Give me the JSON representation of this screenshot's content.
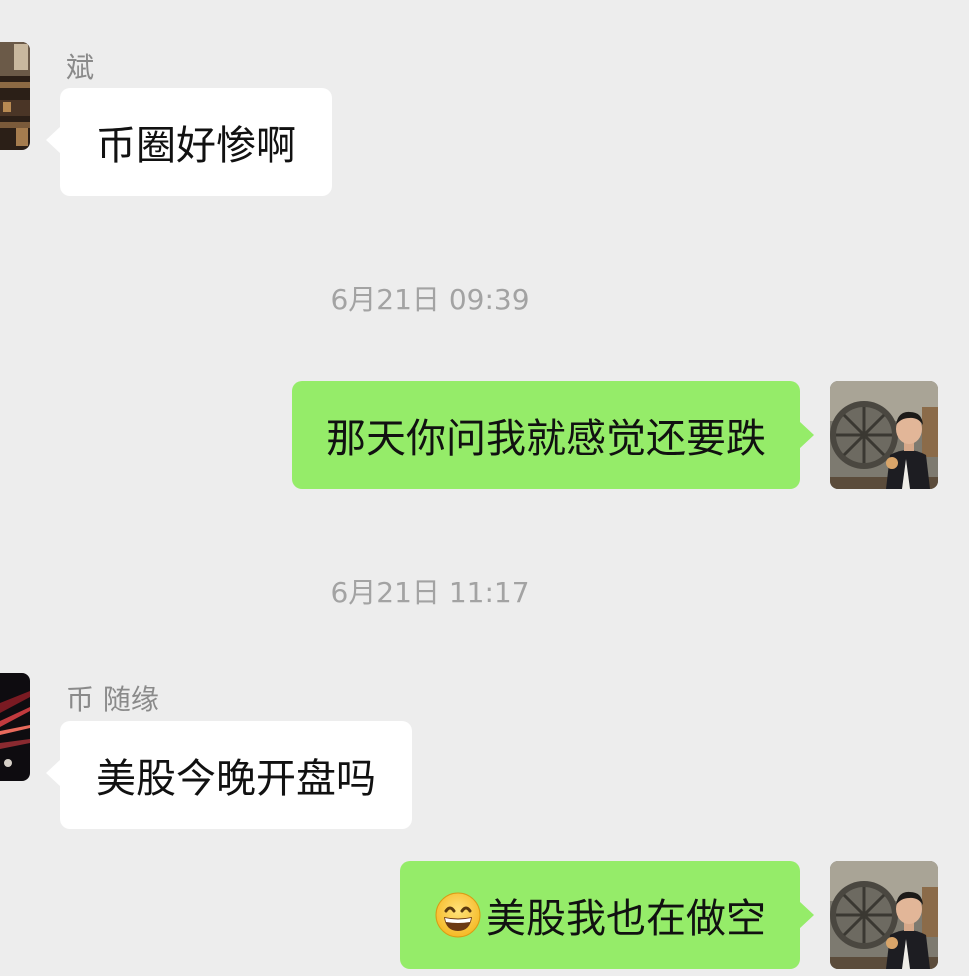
{
  "messages": [
    {
      "sender_name": "斌",
      "text": "币圈好惨啊",
      "direction": "incoming",
      "avatar_icon": "contact-avatar-bin"
    },
    {
      "timestamp": "6月21日 09:39"
    },
    {
      "text": "那天你问我就感觉还要跌",
      "direction": "outgoing",
      "avatar_icon": "my-avatar"
    },
    {
      "timestamp": "6月21日 11:17"
    },
    {
      "sender_name": "币 随缘",
      "text": "美股今晚开盘吗",
      "direction": "incoming",
      "avatar_icon": "contact-avatar-suiyuan"
    },
    {
      "emoji": "grinning-face-emoji",
      "text": "美股我也在做空",
      "direction": "outgoing",
      "avatar_icon": "my-avatar"
    }
  ],
  "colors": {
    "background": "#ededed",
    "incoming_bubble": "#ffffff",
    "outgoing_bubble": "#95ec69",
    "timestamp_text": "#a3a3a3",
    "sender_text": "#8a8a8a"
  }
}
